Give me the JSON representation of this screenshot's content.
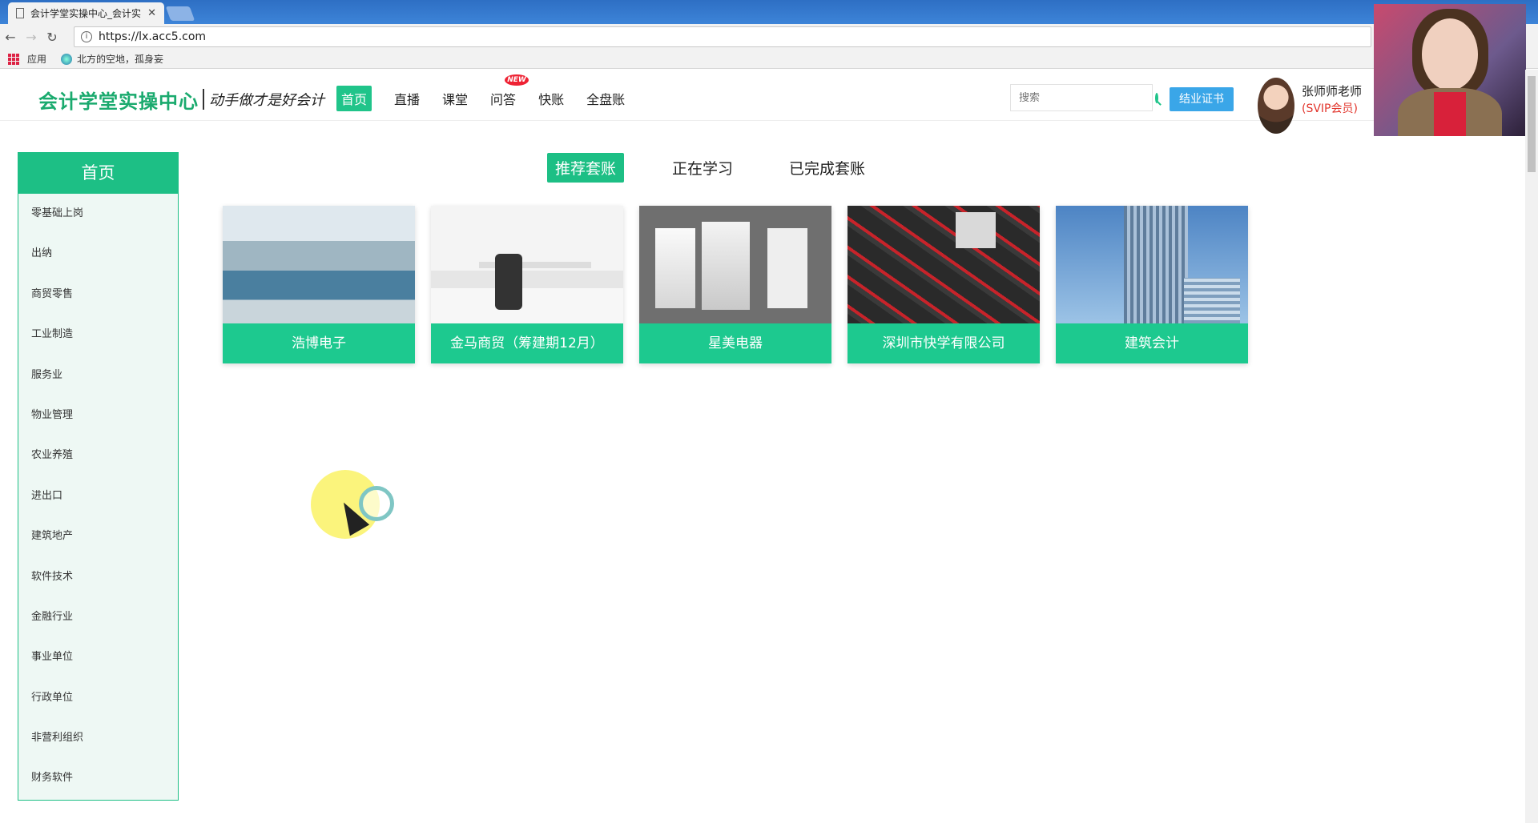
{
  "browser": {
    "tab_title": "会计学堂实操中心_会计实",
    "tab_close": "✕",
    "url": "https://lx.acc5.com",
    "bookmarks": [
      "应用",
      "北方的空地，孤身妄"
    ]
  },
  "header": {
    "logo": "会计学堂实操中心",
    "slogan": "动手做才是好会计",
    "nav": [
      "首页",
      "直播",
      "课堂",
      "问答",
      "快账",
      "全盘账"
    ],
    "new_badge": "NEW",
    "search_placeholder": "搜索",
    "cert_button": "结业证书",
    "user_name": "张师师老师",
    "user_level": "(SVIP会员)"
  },
  "sidebar": {
    "title": "首页",
    "items": [
      "零基础上岗",
      "出纳",
      "商贸零售",
      "工业制造",
      "服务业",
      "物业管理",
      "农业养殖",
      "进出口",
      "建筑地产",
      "软件技术",
      "金融行业",
      "事业单位",
      "行政单位",
      "非营利组织",
      "财务软件"
    ]
  },
  "main": {
    "tabs": [
      "推荐套账",
      "正在学习",
      "已完成套账"
    ],
    "cards": [
      "浩博电子",
      "金马商贸（筹建期12月）",
      "星美电器",
      "深圳市快学有限公司",
      "建筑会计"
    ]
  },
  "colors": {
    "accent": "#1dbf85",
    "cert": "#3aa6e8",
    "vip": "#e2352c"
  }
}
